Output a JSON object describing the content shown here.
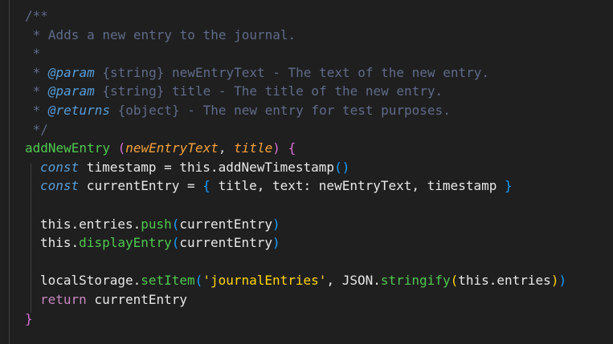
{
  "editor": {
    "lines": [
      {
        "tokens": [
          {
            "t": "/**",
            "c": "c-comment-gray"
          }
        ]
      },
      {
        "tokens": [
          {
            "t": " * Adds a new entry to the journal.",
            "c": "c-comment-gray"
          }
        ]
      },
      {
        "tokens": [
          {
            "t": " *",
            "c": "c-comment-gray"
          }
        ]
      },
      {
        "tokens": [
          {
            "t": " * ",
            "c": "c-comment-gray"
          },
          {
            "t": "@param",
            "c": "c-tag"
          },
          {
            "t": " ",
            "c": "c-comment-gray"
          },
          {
            "t": "{string}",
            "c": "c-comment-gray"
          },
          {
            "t": " newEntryText - The text of the new entry.",
            "c": "c-comment-gray"
          }
        ]
      },
      {
        "tokens": [
          {
            "t": " * ",
            "c": "c-comment-gray"
          },
          {
            "t": "@param",
            "c": "c-tag"
          },
          {
            "t": " ",
            "c": "c-comment-gray"
          },
          {
            "t": "{string}",
            "c": "c-comment-gray"
          },
          {
            "t": " title - The title of the new entry.",
            "c": "c-comment-gray"
          }
        ]
      },
      {
        "tokens": [
          {
            "t": " * ",
            "c": "c-comment-gray"
          },
          {
            "t": "@returns",
            "c": "c-tag"
          },
          {
            "t": " ",
            "c": "c-comment-gray"
          },
          {
            "t": "{object}",
            "c": "c-comment-gray"
          },
          {
            "t": " - The new entry for test purposes.",
            "c": "c-comment-gray"
          }
        ]
      },
      {
        "tokens": [
          {
            "t": " */",
            "c": "c-comment-gray"
          }
        ]
      },
      {
        "tokens": [
          {
            "t": "addNewEntry",
            "c": "c-fn-green"
          },
          {
            "t": " ",
            "c": "c-punc"
          },
          {
            "t": "(",
            "c": "c-brace-p"
          },
          {
            "t": "newEntryText",
            "c": "c-param"
          },
          {
            "t": ", ",
            "c": "c-punc"
          },
          {
            "t": "title",
            "c": "c-param"
          },
          {
            "t": ")",
            "c": "c-brace-p"
          },
          {
            "t": " ",
            "c": "c-punc"
          },
          {
            "t": "{",
            "c": "c-brace-p"
          }
        ]
      },
      {
        "indent": 1,
        "tokens": [
          {
            "t": "const",
            "c": "c-kw"
          },
          {
            "t": " timestamp = this.addNewTimestamp",
            "c": "c-var"
          },
          {
            "t": "()",
            "c": "c-brace-b"
          }
        ]
      },
      {
        "indent": 1,
        "tokens": [
          {
            "t": "const",
            "c": "c-kw"
          },
          {
            "t": " currentEntry = ",
            "c": "c-var"
          },
          {
            "t": "{",
            "c": "c-brace-b"
          },
          {
            "t": " title, text: newEntryText, timestamp ",
            "c": "c-var"
          },
          {
            "t": "}",
            "c": "c-brace-b"
          }
        ]
      },
      {
        "tokens": [
          {
            "t": "",
            "c": "c-var"
          }
        ]
      },
      {
        "indent": 1,
        "tokens": [
          {
            "t": "this.entries.",
            "c": "c-var"
          },
          {
            "t": "push",
            "c": "c-fn-green"
          },
          {
            "t": "(",
            "c": "c-brace-b"
          },
          {
            "t": "currentEntry",
            "c": "c-var"
          },
          {
            "t": ")",
            "c": "c-brace-b"
          }
        ]
      },
      {
        "indent": 1,
        "tokens": [
          {
            "t": "this.",
            "c": "c-var"
          },
          {
            "t": "displayEntry",
            "c": "c-fn-green"
          },
          {
            "t": "(",
            "c": "c-brace-b"
          },
          {
            "t": "currentEntry",
            "c": "c-var"
          },
          {
            "t": ")",
            "c": "c-brace-b"
          }
        ]
      },
      {
        "tokens": [
          {
            "t": "",
            "c": "c-var"
          }
        ]
      },
      {
        "indent": 1,
        "tokens": [
          {
            "t": "localStorage.",
            "c": "c-var"
          },
          {
            "t": "setItem",
            "c": "c-fn-green"
          },
          {
            "t": "(",
            "c": "c-brace-b"
          },
          {
            "t": "'journalEntries'",
            "c": "c-brace-y"
          },
          {
            "t": ", JSON.",
            "c": "c-var"
          },
          {
            "t": "stringify",
            "c": "c-fn-green"
          },
          {
            "t": "(",
            "c": "c-brace-y"
          },
          {
            "t": "this.entries",
            "c": "c-var"
          },
          {
            "t": ")",
            "c": "c-brace-y"
          },
          {
            "t": ")",
            "c": "c-brace-b"
          }
        ]
      },
      {
        "indent": 1,
        "tokens": [
          {
            "t": "return",
            "c": "c-kw-plain"
          },
          {
            "t": " currentEntry",
            "c": "c-var"
          }
        ]
      },
      {
        "tokens": [
          {
            "t": "}",
            "c": "c-brace-p"
          }
        ]
      }
    ]
  }
}
